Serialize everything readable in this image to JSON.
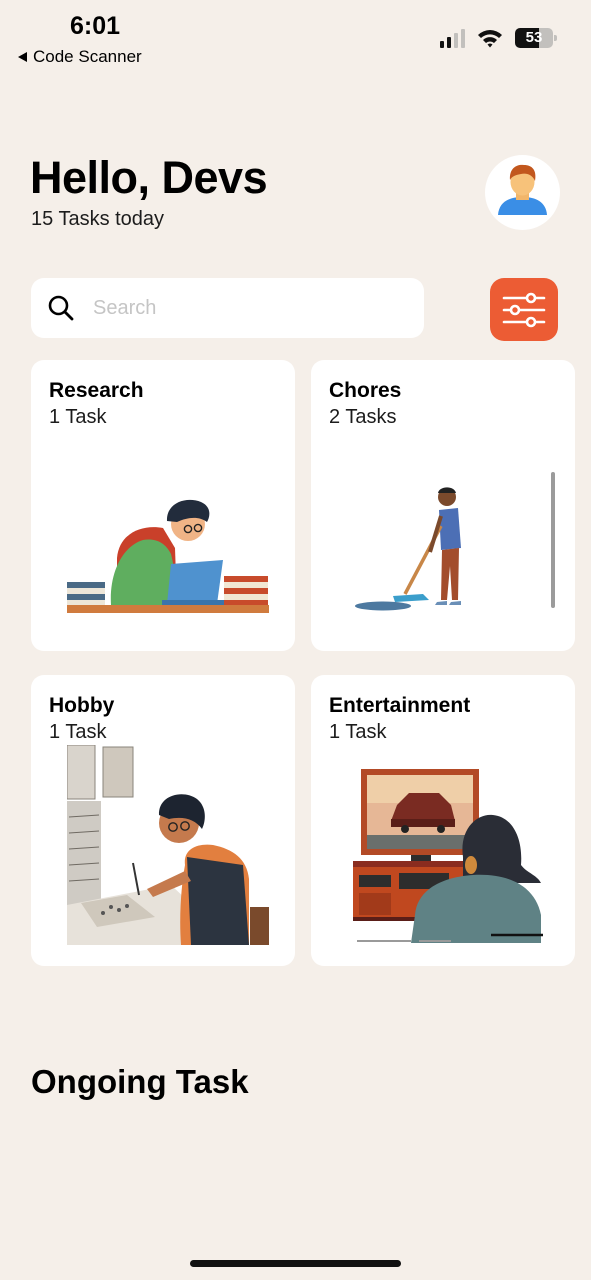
{
  "status_bar": {
    "time": "6:01",
    "back_app": "Code Scanner",
    "battery_level": "53"
  },
  "header": {
    "greeting": "Hello, Devs",
    "subtitle": "15 Tasks today",
    "avatar_icon": "man-avatar-icon"
  },
  "search": {
    "placeholder": "Search",
    "value": ""
  },
  "filter_button_icon": "sliders-icon",
  "accent_color": "#ec5c34",
  "categories": [
    {
      "title": "Research",
      "count": "1 Task",
      "illustration": "man-with-laptop"
    },
    {
      "title": "Chores",
      "count": "2 Tasks",
      "illustration": "person-mopping"
    },
    {
      "title": "Hobby",
      "count": "1 Task",
      "illustration": "person-drawing"
    },
    {
      "title": "Entertainment",
      "count": "1 Task",
      "illustration": "woman-watching-tv"
    }
  ],
  "sections": {
    "ongoing_title": "Ongoing Task"
  }
}
